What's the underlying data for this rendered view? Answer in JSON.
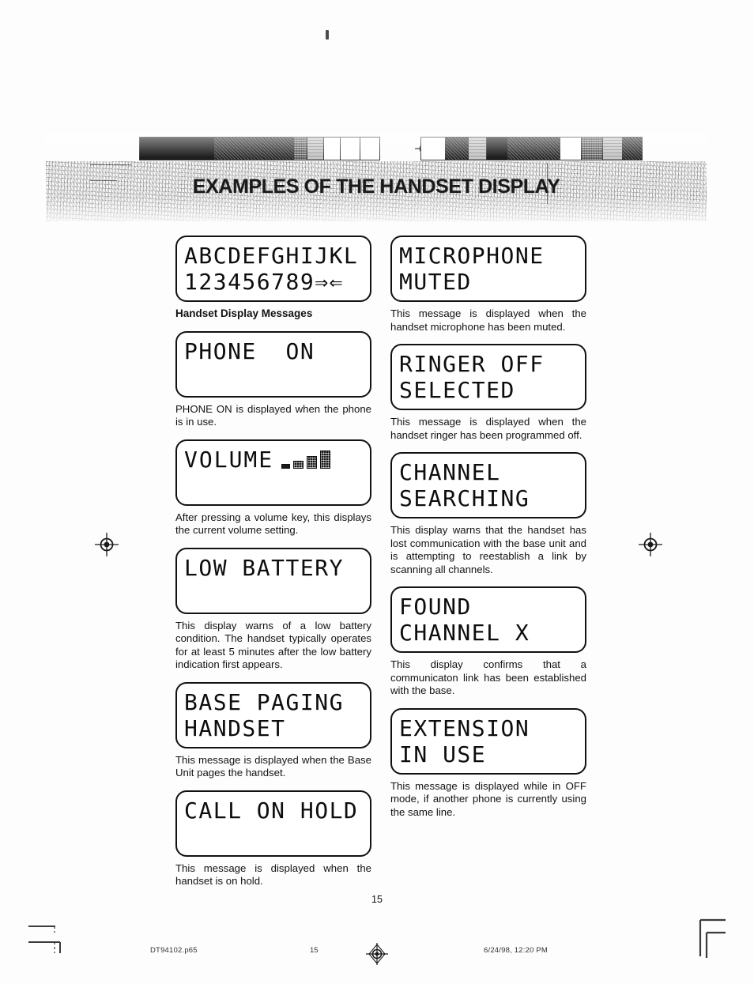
{
  "document": {
    "title": "EXAMPLES OF THE HANDSET DISPLAY",
    "page_number": "15"
  },
  "top_artifact": "ink-speck-mark",
  "banner": {
    "title": "EXAMPLES OF THE HANDSET DISPLAY",
    "calibration_left": [
      "solid",
      "dark",
      "dark",
      "mid",
      "light",
      "white",
      "white",
      "white"
    ],
    "calibration_right": [
      "white",
      "dark",
      "light",
      "solid",
      "dark",
      "dark",
      "white",
      "mid",
      "light",
      "dark"
    ],
    "target_icon": "registration-target-icon"
  },
  "left_column": [
    {
      "id": "charset",
      "lcd_lines": [
        "ABCDEFGHIJKL",
        "123456789⇒⇐"
      ],
      "caption": "Handset Display Messages",
      "caption_style": "label"
    },
    {
      "id": "phone-on",
      "lcd_lines": [
        "PHONE  ON",
        ""
      ],
      "caption": "PHONE ON is displayed when the phone is in use."
    },
    {
      "id": "volume",
      "lcd_lines": [
        "VOLUME",
        ""
      ],
      "lcd_indicator": "volume-bar-graph",
      "volume_bars": 4,
      "caption": "After pressing a volume key, this displays the current volume setting."
    },
    {
      "id": "low-battery",
      "lcd_lines": [
        "LOW BATTERY",
        ""
      ],
      "caption": "This display warns of a low battery condition. The handset typically operates for at least 5 minutes after the low battery indication first appears."
    },
    {
      "id": "base-paging-handset",
      "lcd_lines": [
        "BASE PAGING",
        "HANDSET"
      ],
      "caption": "This message is displayed when the Base Unit pages the handset."
    },
    {
      "id": "call-on-hold",
      "lcd_lines": [
        "CALL ON HOLD",
        ""
      ],
      "caption": "This message is displayed when the handset is on hold."
    }
  ],
  "right_column": [
    {
      "id": "microphone-muted",
      "lcd_lines": [
        "MICROPHONE",
        "MUTED"
      ],
      "caption": "This message is displayed when the handset microphone has been muted."
    },
    {
      "id": "ringer-off-selected",
      "lcd_lines": [
        "RINGER OFF",
        "SELECTED"
      ],
      "caption": "This message is displayed when the handset ringer has been programmed off."
    },
    {
      "id": "channel-searching",
      "lcd_lines": [
        "CHANNEL",
        "SEARCHING"
      ],
      "caption": "This display warns that the handset has lost communication with the base unit and is attempting to reestablish a link by scanning all channels."
    },
    {
      "id": "found-channel-x",
      "lcd_lines": [
        "FOUND",
        "CHANNEL X"
      ],
      "caption": "This display confirms that a communicaton link has been established with the base."
    },
    {
      "id": "extension-in-use",
      "lcd_lines": [
        "EXTENSION",
        "IN USE"
      ],
      "caption": "This message is displayed while in OFF mode, if another phone is currently using the same line."
    }
  ],
  "footer": {
    "page_number": "15",
    "file_name": "DT94102.p65",
    "sheet_number": "15",
    "timestamp": "6/24/98, 12:20 PM",
    "registration_icon": "registration-target-icon",
    "crop_mark_left": "crop-mark-icon",
    "crop_mark_right": "crop-mark-icon"
  }
}
